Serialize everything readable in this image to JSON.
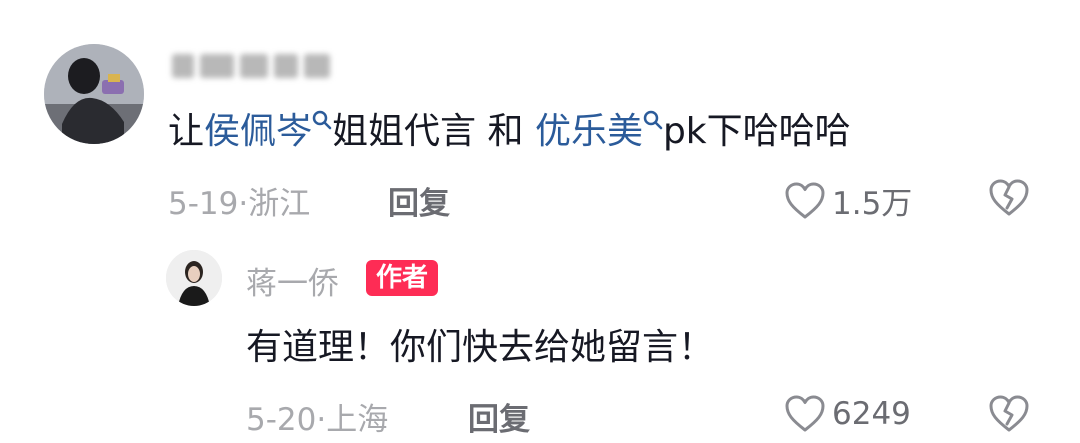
{
  "comment": {
    "text_1": "让",
    "link_1": "侯佩岑",
    "text_2": "姐姐代言 和",
    "link_2": "优乐美",
    "text_3": "pk下哈哈哈",
    "date": "5-19",
    "separator": "·",
    "location": "浙江",
    "reply_label": "回复",
    "like_count": "1.5万"
  },
  "reply": {
    "username": "蒋一侨",
    "author_badge": "作者",
    "text": "有道理！你们快去给她留言！",
    "date": "5-20",
    "separator": "·",
    "location": "上海",
    "reply_label": "回复",
    "like_count": "6249"
  },
  "icons": {
    "like": "heart-icon",
    "dislike": "broken-heart-icon",
    "search": "search-icon"
  },
  "colors": {
    "link": "#2b5b9a",
    "badge": "#fe2c55",
    "meta": "#a8a9ad"
  }
}
